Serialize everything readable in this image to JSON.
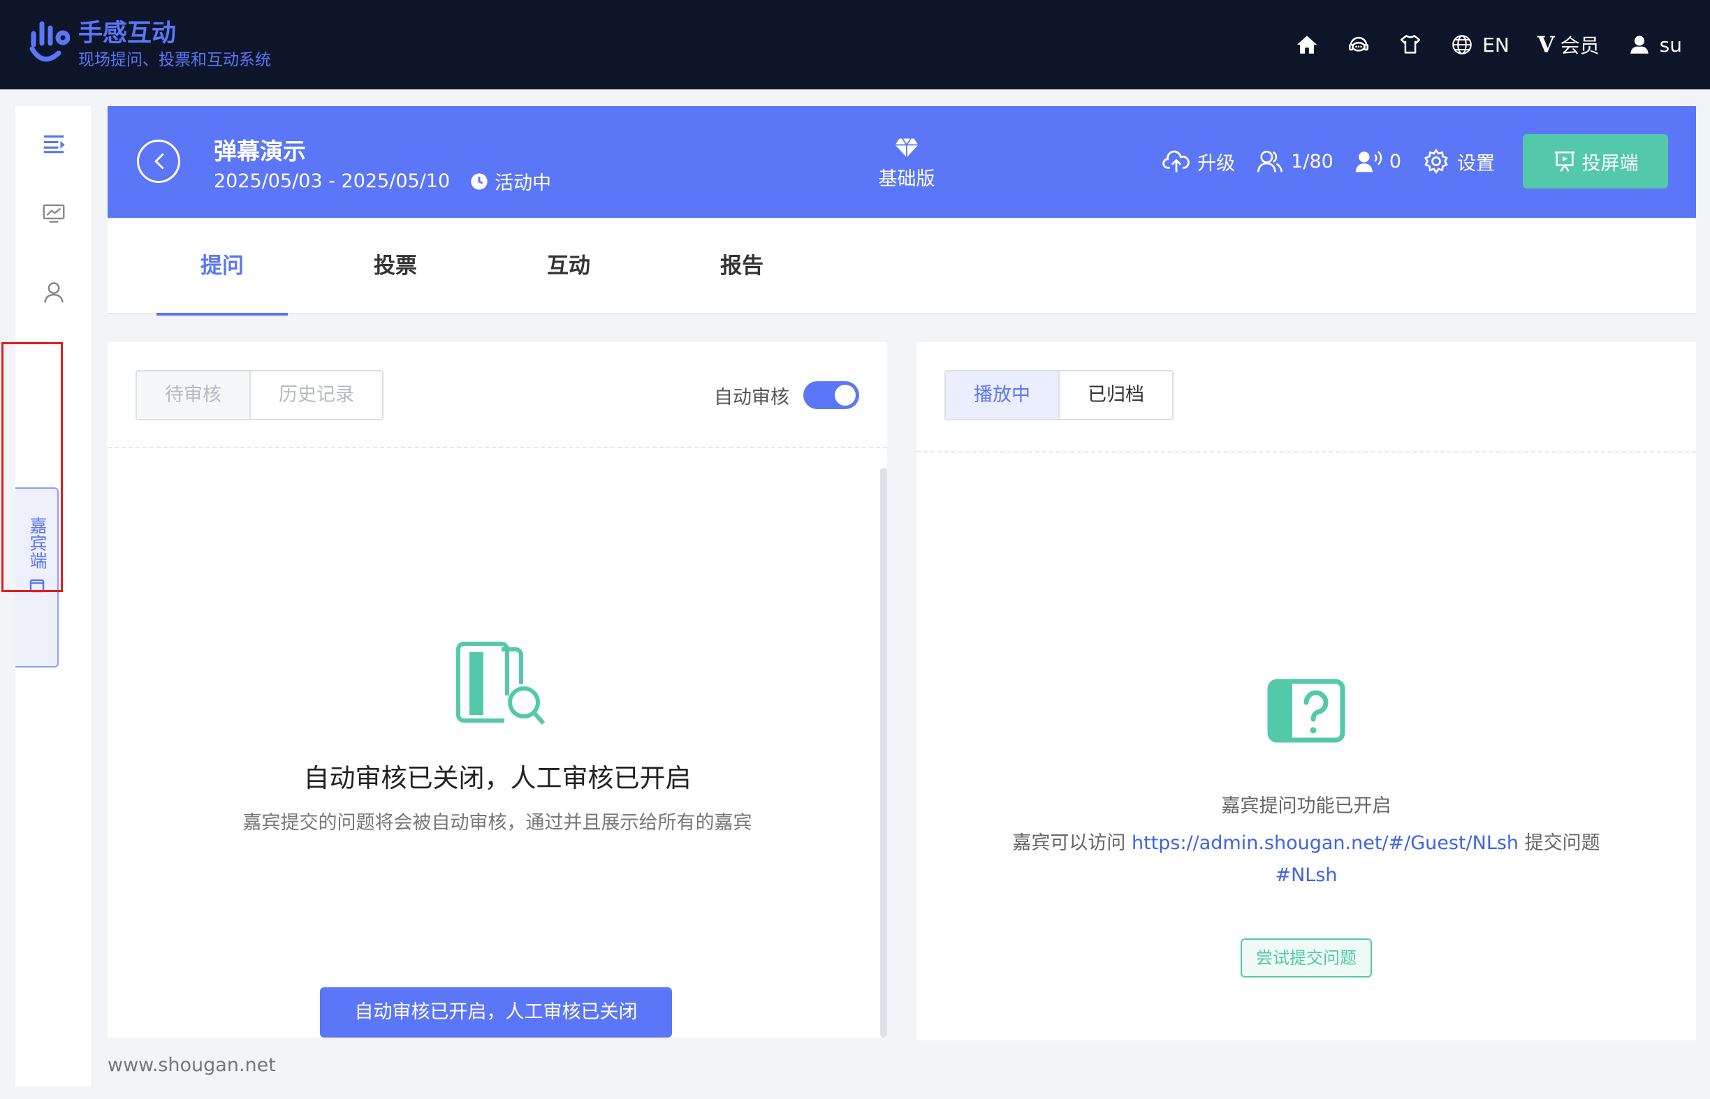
{
  "brand": {
    "name": "手感互动",
    "subtitle": "现场提问、投票和互动系统"
  },
  "topnav": {
    "language": "EN",
    "vip_label": "会员",
    "vip_mark": "V",
    "user": "su"
  },
  "event": {
    "title": "弹幕演示",
    "dates": "2025/05/03 - 2025/05/10",
    "status": "活动中",
    "plan": "基础版",
    "upgrade": "升级",
    "participants": "1/80",
    "online": "0",
    "settings": "设置",
    "screen_button": "投屏端"
  },
  "sidebar": {
    "guest_tab": "嘉宾端"
  },
  "tabs": [
    "提问",
    "投票",
    "互动",
    "报告"
  ],
  "left_panel": {
    "seg": [
      "待审核",
      "历史记录"
    ],
    "auto_review_label": "自动审核",
    "auto_review_on": true,
    "empty_title": "自动审核已关闭，人工审核已开启",
    "empty_subtitle": "嘉宾提交的问题将会被自动审核，通过并且展示给所有的嘉宾",
    "action_button": "自动审核已开启，人工审核已关闭"
  },
  "right_panel": {
    "seg": [
      "播放中",
      "已归档"
    ],
    "line1": "嘉宾提问功能已开启",
    "line2_prefix": "嘉宾可以访问",
    "url": "https://admin.shougan.net/#/Guest/NLsh",
    "line2_suffix": "提交问题",
    "tag": "#NLsh",
    "try_button": "尝试提交问题"
  },
  "footer": "www.shougan.net",
  "colors": {
    "brand": "#5b76f7",
    "accent_green": "#53c9a9",
    "navbar": "#0d1528",
    "highlight_red": "#e11d1d"
  }
}
